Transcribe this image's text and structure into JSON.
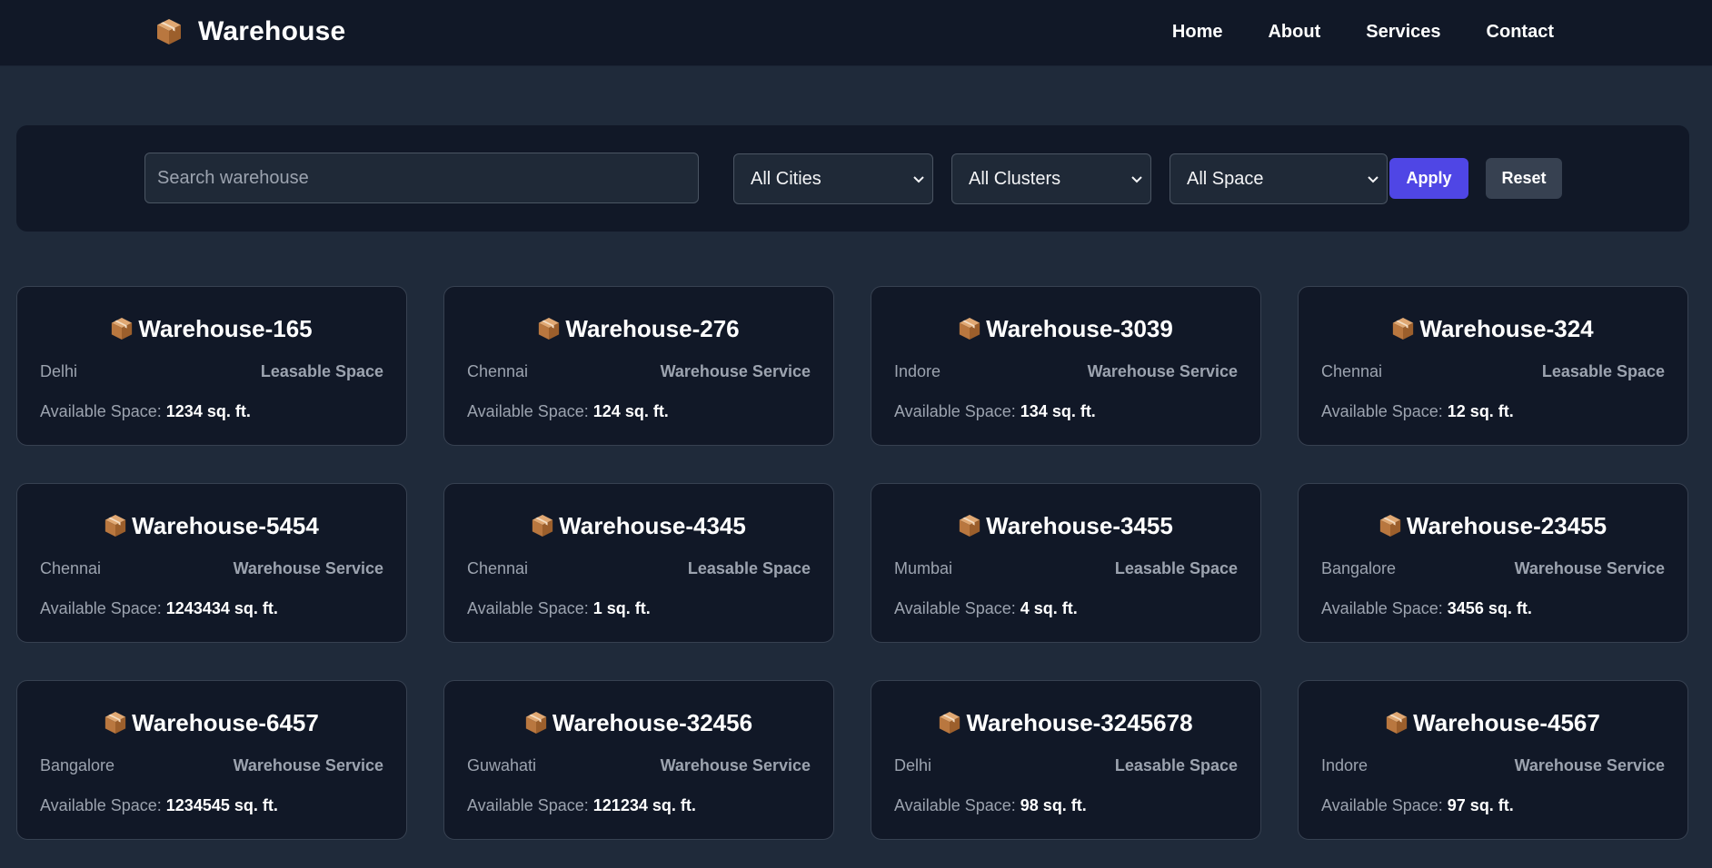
{
  "brand": {
    "name": "Warehouse",
    "icon": "package-icon"
  },
  "nav": {
    "links": [
      "Home",
      "About",
      "Services",
      "Contact"
    ]
  },
  "filters": {
    "search_placeholder": "Search warehouse",
    "search_value": "",
    "city_selected": "All Cities",
    "cluster_selected": "All Clusters",
    "space_selected": "All Space",
    "apply_label": "Apply",
    "reset_label": "Reset"
  },
  "cards_common": {
    "space_label": "Available Space:"
  },
  "warehouses": [
    {
      "name": "Warehouse-165",
      "city": "Delhi",
      "type": "Leasable Space",
      "space": "1234 sq. ft."
    },
    {
      "name": "Warehouse-276",
      "city": "Chennai",
      "type": "Warehouse Service",
      "space": "124 sq. ft."
    },
    {
      "name": "Warehouse-3039",
      "city": "Indore",
      "type": "Warehouse Service",
      "space": "134 sq. ft."
    },
    {
      "name": "Warehouse-324",
      "city": "Chennai",
      "type": "Leasable Space",
      "space": "12 sq. ft."
    },
    {
      "name": "Warehouse-5454",
      "city": "Chennai",
      "type": "Warehouse Service",
      "space": "1243434 sq. ft."
    },
    {
      "name": "Warehouse-4345",
      "city": "Chennai",
      "type": "Leasable Space",
      "space": "1 sq. ft."
    },
    {
      "name": "Warehouse-3455",
      "city": "Mumbai",
      "type": "Leasable Space",
      "space": "4 sq. ft."
    },
    {
      "name": "Warehouse-23455",
      "city": "Bangalore",
      "type": "Warehouse Service",
      "space": "3456 sq. ft."
    },
    {
      "name": "Warehouse-6457",
      "city": "Bangalore",
      "type": "Warehouse Service",
      "space": "1234545 sq. ft."
    },
    {
      "name": "Warehouse-32456",
      "city": "Guwahati",
      "type": "Warehouse Service",
      "space": "121234 sq. ft."
    },
    {
      "name": "Warehouse-3245678",
      "city": "Delhi",
      "type": "Leasable Space",
      "space": "98 sq. ft."
    },
    {
      "name": "Warehouse-4567",
      "city": "Indore",
      "type": "Warehouse Service",
      "space": "97 sq. ft."
    }
  ],
  "colors": {
    "page_bg": "#1f2a3a",
    "panel_bg": "#111827",
    "accent": "#4f46e5",
    "reset_bg": "#374151",
    "box_brown": "#c2864e"
  }
}
